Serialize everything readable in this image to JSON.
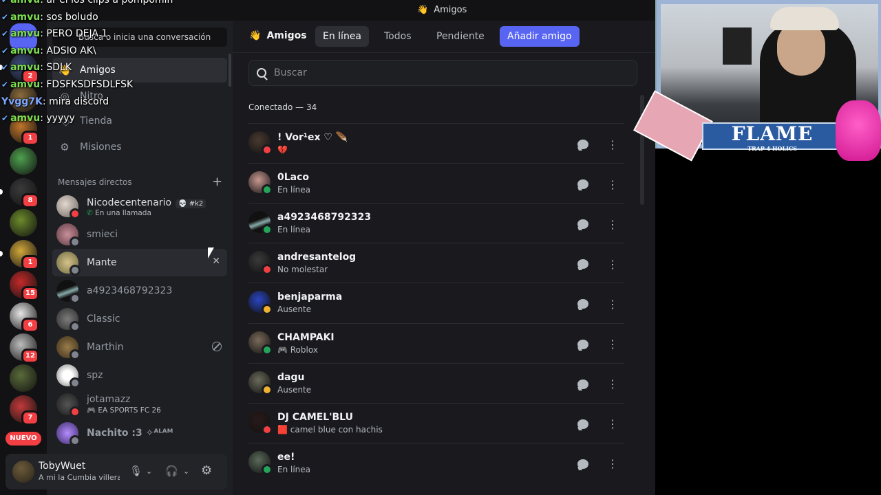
{
  "window": {
    "title": "Amigos"
  },
  "sidebar": {
    "search_placeholder": "Busca o inicia una conversación",
    "nav": [
      {
        "label": "Amigos",
        "icon": "friends-icon",
        "active": true
      },
      {
        "label": "Nitro",
        "icon": "nitro-icon"
      },
      {
        "label": "Tienda",
        "icon": "shop-icon"
      },
      {
        "label": "Misiones",
        "icon": "quests-icon"
      }
    ],
    "dm_header": "Mensajes directos",
    "dm_add": "+",
    "dms": [
      {
        "name": "Nicodecentenario",
        "tag": "💀 #k2",
        "sub": "En una llamada",
        "status": "dnd"
      },
      {
        "name": "smieci",
        "status": "off"
      },
      {
        "name": "Mante",
        "status": "off"
      },
      {
        "name": "a4923468792323",
        "status": "off"
      },
      {
        "name": "Classic",
        "status": "off"
      },
      {
        "name": "Marthin",
        "status": "off"
      },
      {
        "name": "spz",
        "status": "off"
      },
      {
        "name": "jotamazz",
        "sub": "EA SPORTS FC 26",
        "status": "dnd"
      },
      {
        "name": "Nachito :3 ✧ᴬᴸᴬᴹ",
        "status": "off"
      }
    ]
  },
  "user": {
    "name": "TobyWuet",
    "status": "A mi la Cumbia villera n"
  },
  "servers": [
    {
      "badge": "2"
    },
    {
      "badge": ""
    },
    {
      "badge": "1"
    },
    {
      "badge": ""
    },
    {
      "badge": "8"
    },
    {
      "badge": ""
    },
    {
      "badge": "1"
    },
    {
      "badge": "15"
    },
    {
      "badge": "6"
    },
    {
      "badge": "12"
    },
    {
      "badge": ""
    },
    {
      "badge": "7"
    }
  ],
  "nuevo": "NUEVO",
  "topbar": {
    "friends": "Amigos",
    "tabs": [
      "En línea",
      "Todos",
      "Pendiente"
    ],
    "add_friend": "Añadir amigo"
  },
  "friends_search": "Buscar",
  "online_count": "Conectado — 34",
  "friends": [
    {
      "name": "! Vor¹ex ♡ 🪶",
      "status_text": "💔",
      "status": "dnd"
    },
    {
      "name": "0Laco",
      "status_text": "En línea",
      "status": "on"
    },
    {
      "name": "a4923468792323",
      "status_text": "En línea",
      "status": "on"
    },
    {
      "name": "andresantelog",
      "status_text": "No molestar",
      "status": "dnd"
    },
    {
      "name": "benjaparma",
      "status_text": "Ausente",
      "status": "idle"
    },
    {
      "name": "CHAMPAKI",
      "status_text": "🎮 Roblox",
      "status": "on"
    },
    {
      "name": "dagu",
      "status_text": "Ausente",
      "status": "idle"
    },
    {
      "name": "DJ CAMEL'BLU",
      "status_text": "🟥 camel blue con hachis",
      "status": "dnd"
    },
    {
      "name": "ee!",
      "status_text": "En línea",
      "status": "on"
    }
  ],
  "chat": [
    {
      "user": "amvu",
      "msg": "ar el los clips a pompomin"
    },
    {
      "user": "amvu",
      "msg": "sos boludo"
    },
    {
      "user": "amvu",
      "msg": "PERO DEJA 1"
    },
    {
      "user": "amvu",
      "msg": "ADSIO AK\\"
    },
    {
      "user": "amvu",
      "msg": "SDLK"
    },
    {
      "user": "amvu",
      "msg": "FDSFKSDFSDLFSK"
    },
    {
      "user": "Yvgg7K",
      "msg": "mira discord"
    },
    {
      "user": "amvu",
      "msg": "yyyyy"
    }
  ],
  "overlay": {
    "flame": "FLAME",
    "flame_sub": "TRAP 4 HOLICS"
  }
}
